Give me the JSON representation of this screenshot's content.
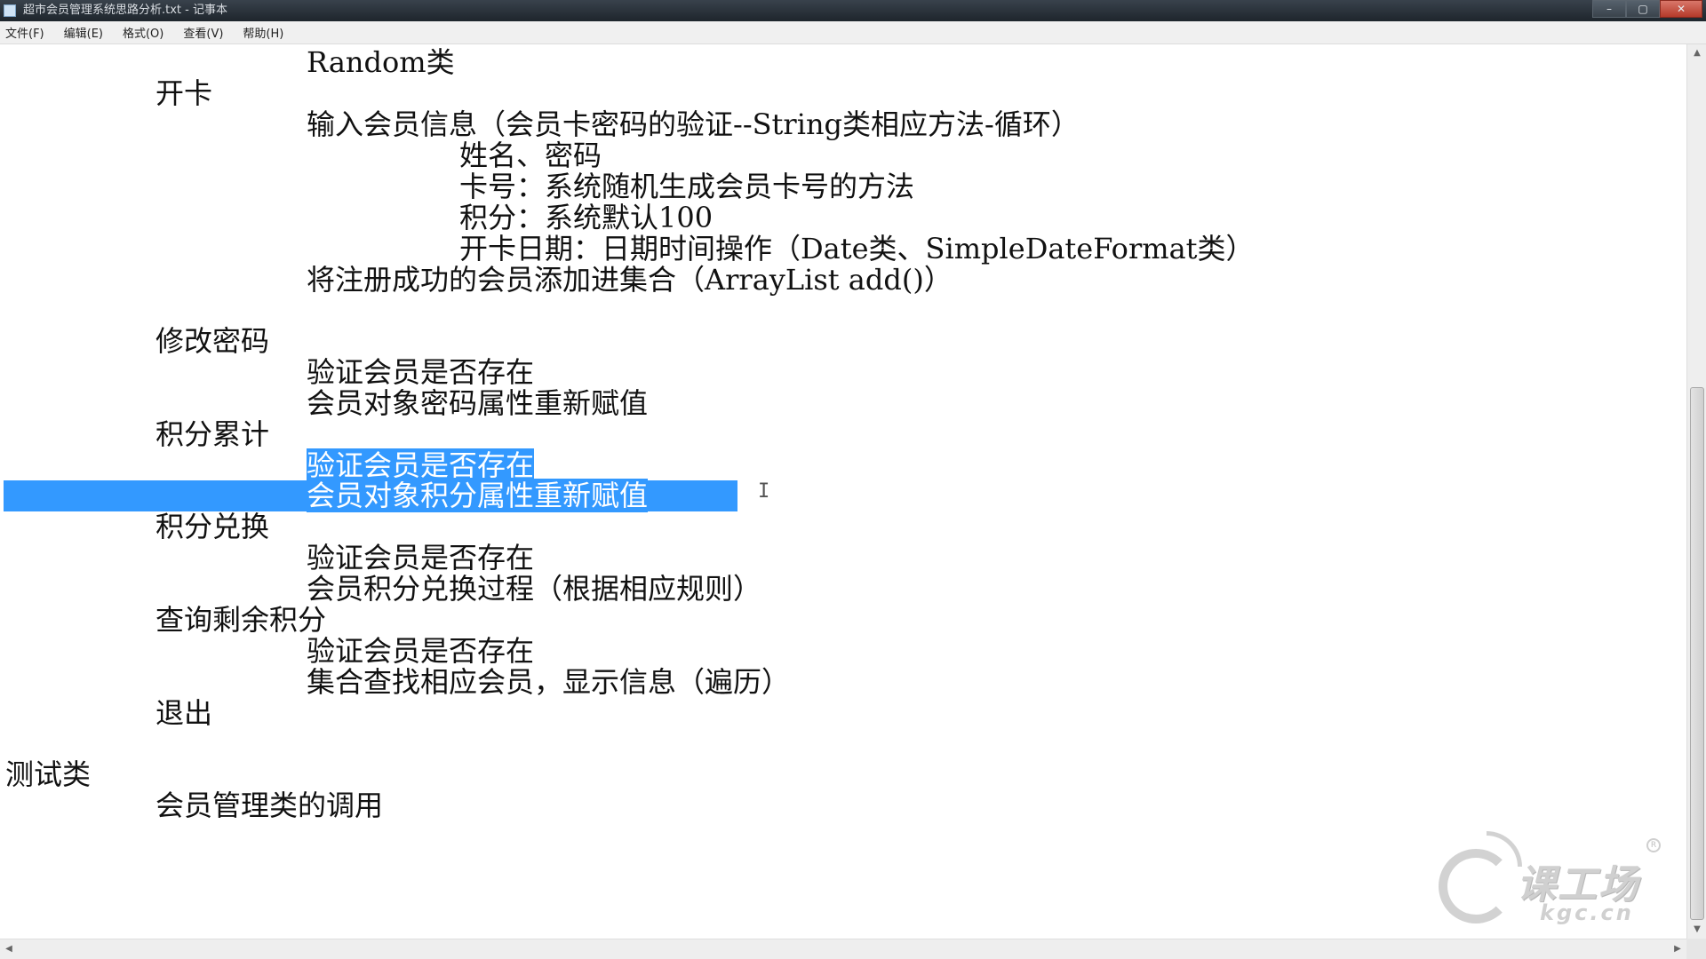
{
  "window": {
    "title": "超市会员管理系统思路分析.txt - 记事本",
    "controls": {
      "minimize": "–",
      "maximize": "▢",
      "close": "✕"
    }
  },
  "menu": {
    "file": "文件(F)",
    "edit": "编辑(E)",
    "format": "格式(O)",
    "view": "查看(V)",
    "help": "帮助(H)"
  },
  "document": {
    "lines": [
      "Random类",
      "开卡",
      "输入会员信息（会员卡密码的验证--String类相应方法-循环）",
      "姓名、密码",
      "卡号：系统随机生成会员卡号的方法",
      "积分：系统默认100",
      "开卡日期：日期时间操作（Date类、SimpleDateFormat类）",
      "将注册成功的会员添加进集合（ArrayList add()）",
      "修改密码",
      "验证会员是否存在",
      "会员对象密码属性重新赋值",
      "积分累计",
      "验证会员是否存在",
      "会员对象积分属性重新赋值",
      "积分兑换",
      "验证会员是否存在",
      "会员积分兑换过程（根据相应规则）",
      "查询剩余积分",
      "验证会员是否存在",
      "集合查找相应会员，显示信息（遍历）",
      "退出",
      "测试类",
      "会员管理类的调用"
    ],
    "selected_lines": [
      12,
      13
    ]
  },
  "cursor_glyph": "I",
  "watermark": {
    "brand": "课工场",
    "domain": "kgc.cn",
    "registered": "R"
  },
  "colors": {
    "selection": "#3399ff",
    "titlebar": "#2b333b",
    "menubar": "#f0f0f0"
  }
}
